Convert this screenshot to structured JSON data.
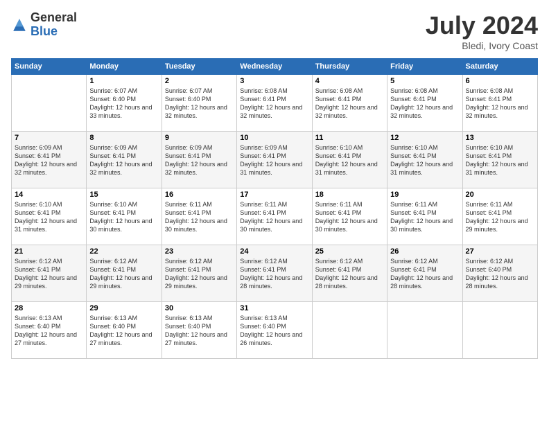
{
  "logo": {
    "general": "General",
    "blue": "Blue"
  },
  "header": {
    "month": "July 2024",
    "location": "Bledi, Ivory Coast"
  },
  "days": [
    "Sunday",
    "Monday",
    "Tuesday",
    "Wednesday",
    "Thursday",
    "Friday",
    "Saturday"
  ],
  "weeks": [
    [
      {
        "day": "",
        "sunrise": "",
        "sunset": "",
        "daylight": ""
      },
      {
        "day": "1",
        "sunrise": "Sunrise: 6:07 AM",
        "sunset": "Sunset: 6:40 PM",
        "daylight": "Daylight: 12 hours and 33 minutes."
      },
      {
        "day": "2",
        "sunrise": "Sunrise: 6:07 AM",
        "sunset": "Sunset: 6:40 PM",
        "daylight": "Daylight: 12 hours and 32 minutes."
      },
      {
        "day": "3",
        "sunrise": "Sunrise: 6:08 AM",
        "sunset": "Sunset: 6:41 PM",
        "daylight": "Daylight: 12 hours and 32 minutes."
      },
      {
        "day": "4",
        "sunrise": "Sunrise: 6:08 AM",
        "sunset": "Sunset: 6:41 PM",
        "daylight": "Daylight: 12 hours and 32 minutes."
      },
      {
        "day": "5",
        "sunrise": "Sunrise: 6:08 AM",
        "sunset": "Sunset: 6:41 PM",
        "daylight": "Daylight: 12 hours and 32 minutes."
      },
      {
        "day": "6",
        "sunrise": "Sunrise: 6:08 AM",
        "sunset": "Sunset: 6:41 PM",
        "daylight": "Daylight: 12 hours and 32 minutes."
      }
    ],
    [
      {
        "day": "7",
        "sunrise": "Sunrise: 6:09 AM",
        "sunset": "Sunset: 6:41 PM",
        "daylight": "Daylight: 12 hours and 32 minutes."
      },
      {
        "day": "8",
        "sunrise": "Sunrise: 6:09 AM",
        "sunset": "Sunset: 6:41 PM",
        "daylight": "Daylight: 12 hours and 32 minutes."
      },
      {
        "day": "9",
        "sunrise": "Sunrise: 6:09 AM",
        "sunset": "Sunset: 6:41 PM",
        "daylight": "Daylight: 12 hours and 32 minutes."
      },
      {
        "day": "10",
        "sunrise": "Sunrise: 6:09 AM",
        "sunset": "Sunset: 6:41 PM",
        "daylight": "Daylight: 12 hours and 31 minutes."
      },
      {
        "day": "11",
        "sunrise": "Sunrise: 6:10 AM",
        "sunset": "Sunset: 6:41 PM",
        "daylight": "Daylight: 12 hours and 31 minutes."
      },
      {
        "day": "12",
        "sunrise": "Sunrise: 6:10 AM",
        "sunset": "Sunset: 6:41 PM",
        "daylight": "Daylight: 12 hours and 31 minutes."
      },
      {
        "day": "13",
        "sunrise": "Sunrise: 6:10 AM",
        "sunset": "Sunset: 6:41 PM",
        "daylight": "Daylight: 12 hours and 31 minutes."
      }
    ],
    [
      {
        "day": "14",
        "sunrise": "Sunrise: 6:10 AM",
        "sunset": "Sunset: 6:41 PM",
        "daylight": "Daylight: 12 hours and 31 minutes."
      },
      {
        "day": "15",
        "sunrise": "Sunrise: 6:10 AM",
        "sunset": "Sunset: 6:41 PM",
        "daylight": "Daylight: 12 hours and 30 minutes."
      },
      {
        "day": "16",
        "sunrise": "Sunrise: 6:11 AM",
        "sunset": "Sunset: 6:41 PM",
        "daylight": "Daylight: 12 hours and 30 minutes."
      },
      {
        "day": "17",
        "sunrise": "Sunrise: 6:11 AM",
        "sunset": "Sunset: 6:41 PM",
        "daylight": "Daylight: 12 hours and 30 minutes."
      },
      {
        "day": "18",
        "sunrise": "Sunrise: 6:11 AM",
        "sunset": "Sunset: 6:41 PM",
        "daylight": "Daylight: 12 hours and 30 minutes."
      },
      {
        "day": "19",
        "sunrise": "Sunrise: 6:11 AM",
        "sunset": "Sunset: 6:41 PM",
        "daylight": "Daylight: 12 hours and 30 minutes."
      },
      {
        "day": "20",
        "sunrise": "Sunrise: 6:11 AM",
        "sunset": "Sunset: 6:41 PM",
        "daylight": "Daylight: 12 hours and 29 minutes."
      }
    ],
    [
      {
        "day": "21",
        "sunrise": "Sunrise: 6:12 AM",
        "sunset": "Sunset: 6:41 PM",
        "daylight": "Daylight: 12 hours and 29 minutes."
      },
      {
        "day": "22",
        "sunrise": "Sunrise: 6:12 AM",
        "sunset": "Sunset: 6:41 PM",
        "daylight": "Daylight: 12 hours and 29 minutes."
      },
      {
        "day": "23",
        "sunrise": "Sunrise: 6:12 AM",
        "sunset": "Sunset: 6:41 PM",
        "daylight": "Daylight: 12 hours and 29 minutes."
      },
      {
        "day": "24",
        "sunrise": "Sunrise: 6:12 AM",
        "sunset": "Sunset: 6:41 PM",
        "daylight": "Daylight: 12 hours and 28 minutes."
      },
      {
        "day": "25",
        "sunrise": "Sunrise: 6:12 AM",
        "sunset": "Sunset: 6:41 PM",
        "daylight": "Daylight: 12 hours and 28 minutes."
      },
      {
        "day": "26",
        "sunrise": "Sunrise: 6:12 AM",
        "sunset": "Sunset: 6:41 PM",
        "daylight": "Daylight: 12 hours and 28 minutes."
      },
      {
        "day": "27",
        "sunrise": "Sunrise: 6:12 AM",
        "sunset": "Sunset: 6:40 PM",
        "daylight": "Daylight: 12 hours and 28 minutes."
      }
    ],
    [
      {
        "day": "28",
        "sunrise": "Sunrise: 6:13 AM",
        "sunset": "Sunset: 6:40 PM",
        "daylight": "Daylight: 12 hours and 27 minutes."
      },
      {
        "day": "29",
        "sunrise": "Sunrise: 6:13 AM",
        "sunset": "Sunset: 6:40 PM",
        "daylight": "Daylight: 12 hours and 27 minutes."
      },
      {
        "day": "30",
        "sunrise": "Sunrise: 6:13 AM",
        "sunset": "Sunset: 6:40 PM",
        "daylight": "Daylight: 12 hours and 27 minutes."
      },
      {
        "day": "31",
        "sunrise": "Sunrise: 6:13 AM",
        "sunset": "Sunset: 6:40 PM",
        "daylight": "Daylight: 12 hours and 26 minutes."
      },
      {
        "day": "",
        "sunrise": "",
        "sunset": "",
        "daylight": ""
      },
      {
        "day": "",
        "sunrise": "",
        "sunset": "",
        "daylight": ""
      },
      {
        "day": "",
        "sunrise": "",
        "sunset": "",
        "daylight": ""
      }
    ]
  ]
}
